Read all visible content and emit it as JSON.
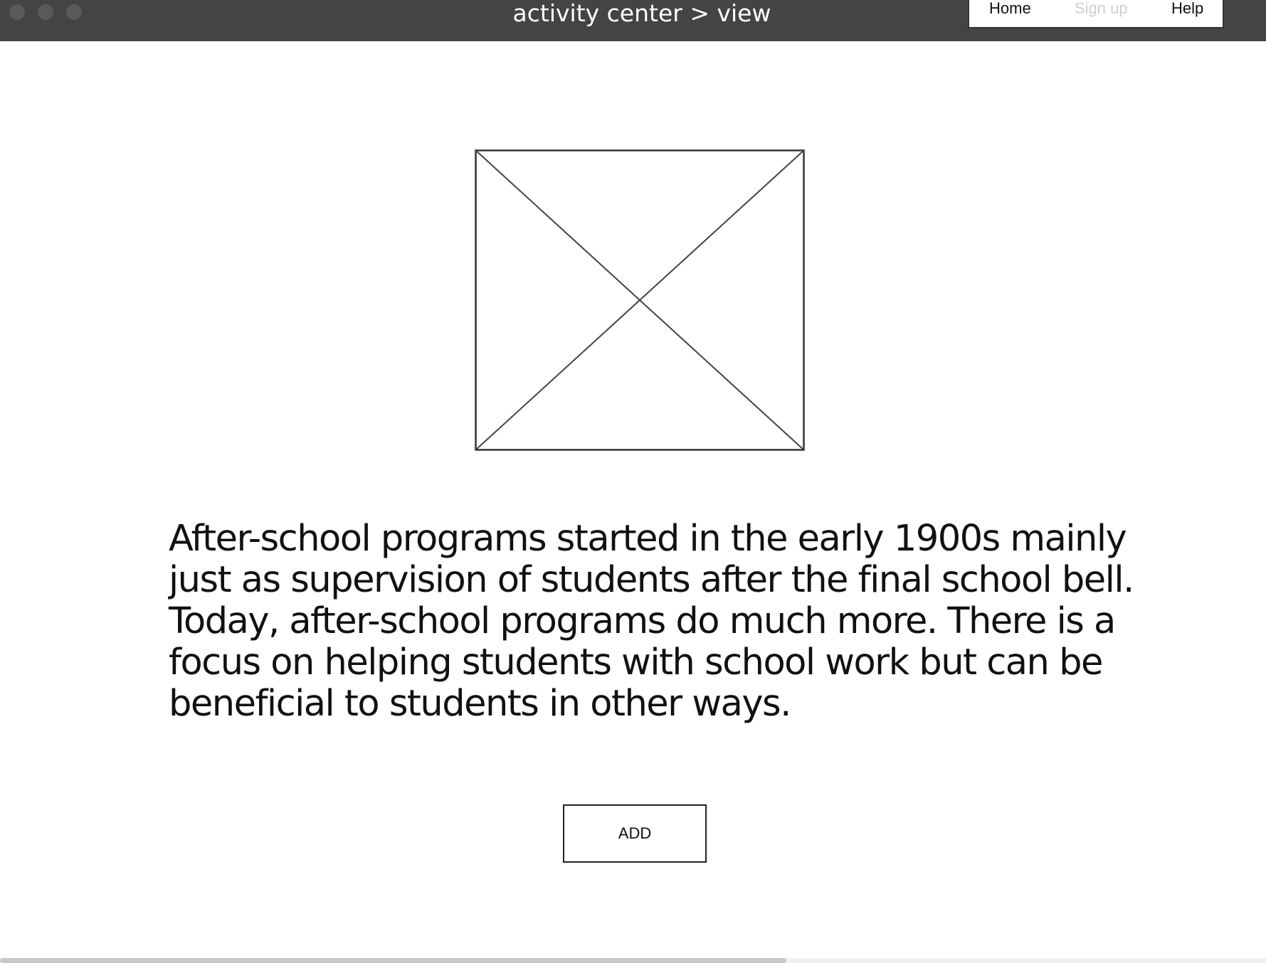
{
  "window": {
    "title": "activity center > view"
  },
  "nav": {
    "items": [
      {
        "label": "Home",
        "state": "active"
      },
      {
        "label": "Sign up",
        "state": "disabled"
      },
      {
        "label": "Help",
        "state": "active"
      }
    ]
  },
  "main": {
    "image_placeholder": "image-placeholder-icon",
    "description": "After-school programs started in the early 1900s mainly just as supervision of students after the final school bell. Today, after-school programs do much more. There is a focus on helping students with school work but can be beneficial to students in other ways.",
    "add_button_label": "ADD"
  },
  "colors": {
    "titlebar": "#444444",
    "disabled_text": "#cfcfcf"
  }
}
